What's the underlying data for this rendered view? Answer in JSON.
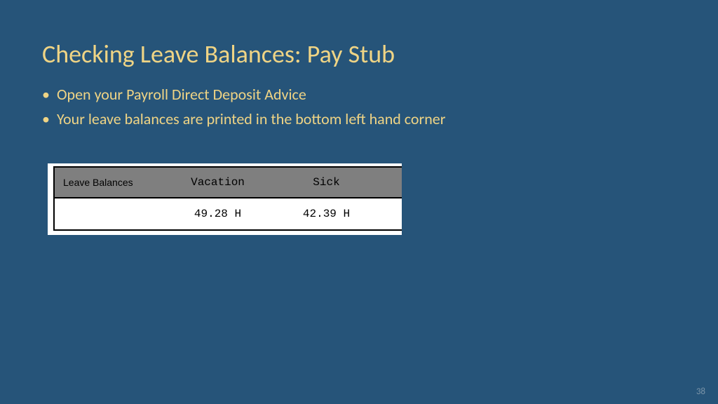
{
  "title": "Checking Leave Balances:  Pay Stub",
  "bullets": [
    "Open your Payroll Direct Deposit Advice",
    "Your leave balances are printed in the bottom left hand corner"
  ],
  "paystub": {
    "header": {
      "label": "Leave Balances",
      "col1": "Vacation",
      "col2": "Sick"
    },
    "values": {
      "col1": "49.28 H",
      "col2": "42.39 H"
    }
  },
  "page_number": "38"
}
